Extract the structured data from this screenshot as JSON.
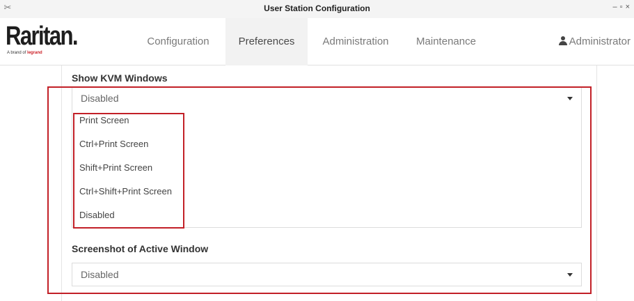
{
  "window": {
    "title": "User Station Configuration",
    "controls": [
      "–",
      "▫",
      "×"
    ]
  },
  "brand": {
    "name": "Raritan.",
    "tagline_prefix": "A brand of",
    "tagline_brand": "legrand"
  },
  "nav": {
    "items": [
      {
        "label": "Configuration",
        "active": false
      },
      {
        "label": "Preferences",
        "active": true
      },
      {
        "label": "Administration",
        "active": false
      },
      {
        "label": "Maintenance",
        "active": false
      }
    ],
    "user_label": "Administrator"
  },
  "settings": {
    "kvm": {
      "label": "Show KVM Windows",
      "selected": "Disabled",
      "options": [
        "Print Screen",
        "Ctrl+Print Screen",
        "Shift+Print Screen",
        "Ctrl+Shift+Print Screen",
        "Disabled"
      ]
    },
    "active_window": {
      "label": "Screenshot of Active Window",
      "selected": "Disabled"
    }
  },
  "colors": {
    "highlight": "#c22027",
    "active_tab_bg": "#f2f2f2",
    "logo_accent": "#cc1f26"
  }
}
